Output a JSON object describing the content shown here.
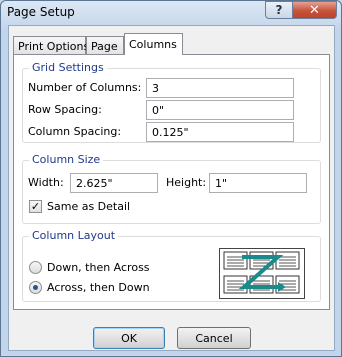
{
  "window": {
    "title": "Page Setup",
    "help_glyph": "?",
    "close_glyph": "✕"
  },
  "tabs": [
    {
      "label": "Print Options",
      "active": false
    },
    {
      "label": "Page",
      "active": false
    },
    {
      "label": "Columns",
      "active": true
    }
  ],
  "grid_settings": {
    "title": "Grid Settings",
    "number_of_columns": {
      "label": "Number of Columns:",
      "value": "3"
    },
    "row_spacing": {
      "label": "Row Spacing:",
      "value": "0\""
    },
    "column_spacing": {
      "label": "Column Spacing:",
      "value": "0.125\""
    }
  },
  "column_size": {
    "title": "Column Size",
    "width": {
      "label": "Width:",
      "value": "2.625\""
    },
    "height": {
      "label": "Height:",
      "value": "1\""
    },
    "same_as_detail": {
      "label": "Same as Detail",
      "checked": true,
      "check_glyph": "✓"
    }
  },
  "column_layout": {
    "title": "Column Layout",
    "options": [
      {
        "label": "Down, then Across",
        "selected": false
      },
      {
        "label": "Across, then Down",
        "selected": true
      }
    ],
    "preview_icon": "across-then-down-layout-icon"
  },
  "buttons": {
    "ok": "OK",
    "cancel": "Cancel"
  },
  "colors": {
    "group_title": "#1e3a8a",
    "preview_z": "#1a8a8a",
    "close_red": "#c0412a"
  }
}
